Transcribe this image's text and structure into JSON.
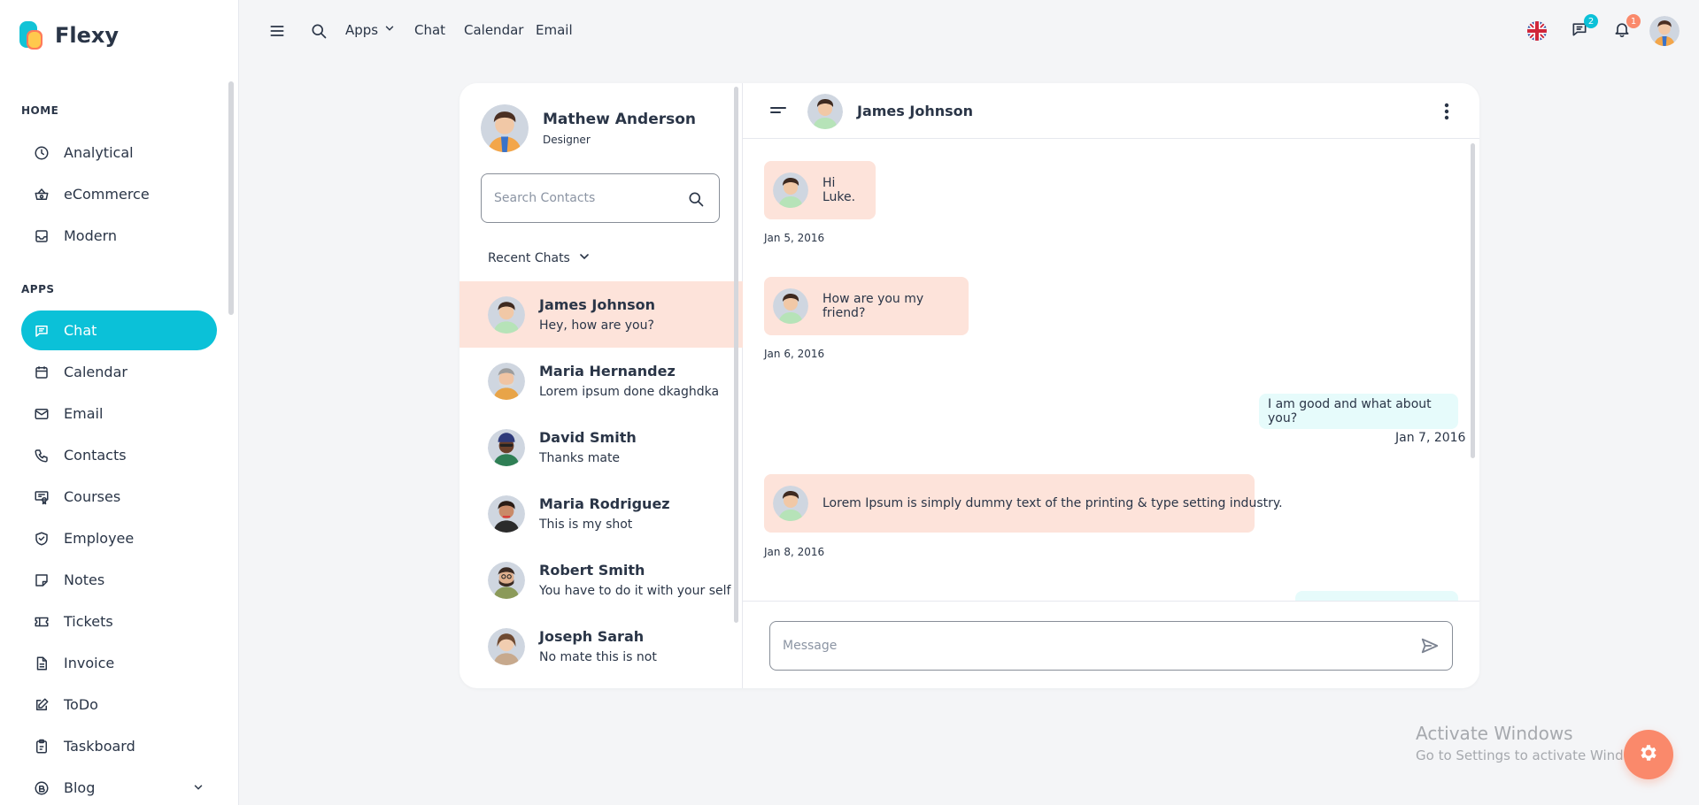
{
  "brand": {
    "name": "Flexy"
  },
  "sidebar": {
    "sections": [
      {
        "caption": "HOME",
        "items": [
          {
            "label": "Analytical",
            "icon": "clock-icon"
          },
          {
            "label": "eCommerce",
            "icon": "basket-icon"
          },
          {
            "label": "Modern",
            "icon": "inbox-icon"
          }
        ]
      },
      {
        "caption": "APPS",
        "items": [
          {
            "label": "Chat",
            "icon": "message-icon",
            "active": true
          },
          {
            "label": "Calendar",
            "icon": "calendar-icon"
          },
          {
            "label": "Email",
            "icon": "mail-icon"
          },
          {
            "label": "Contacts",
            "icon": "phone-icon"
          },
          {
            "label": "Courses",
            "icon": "certificate-icon"
          },
          {
            "label": "Employee",
            "icon": "shield-icon"
          },
          {
            "label": "Notes",
            "icon": "note-icon"
          },
          {
            "label": "Tickets",
            "icon": "ticket-icon"
          },
          {
            "label": "Invoice",
            "icon": "file-invoice-icon"
          },
          {
            "label": "ToDo",
            "icon": "edit-icon"
          },
          {
            "label": "Taskboard",
            "icon": "clipboard-icon"
          },
          {
            "label": "Blog",
            "icon": "blog-icon",
            "has_children": true
          }
        ]
      }
    ]
  },
  "topbar": {
    "links": [
      "Apps",
      "Chat",
      "Calendar",
      "Email"
    ],
    "messages_badge": "2",
    "notifications_badge": "1"
  },
  "profile": {
    "name": "Mathew Anderson",
    "role": "Designer"
  },
  "search": {
    "placeholder": "Search Contacts"
  },
  "recent_label": "Recent Chats",
  "contacts": [
    {
      "name": "James Johnson",
      "message": "Hey, how are you?",
      "selected": true
    },
    {
      "name": "Maria Hernandez",
      "message": "Lorem ipsum done dkaghdka"
    },
    {
      "name": "David Smith",
      "message": "Thanks mate"
    },
    {
      "name": "Maria Rodriguez",
      "message": "This is my shot"
    },
    {
      "name": "Robert Smith",
      "message": "You have to do it with your self"
    },
    {
      "name": "Joseph Sarah",
      "message": "No mate this is not"
    }
  ],
  "chat": {
    "partner": "James Johnson",
    "messages": [
      {
        "dir": "in",
        "text": "Hi Luke.",
        "date": "Jan 5, 2016"
      },
      {
        "dir": "in",
        "text": "How are you my friend?",
        "date": "Jan 6, 2016"
      },
      {
        "dir": "out",
        "text": "I am good and what about you?",
        "date": "Jan 7, 2016"
      },
      {
        "dir": "in",
        "text": "Lorem Ipsum is simply dummy text of the printing & type setting industry.",
        "date": "Jan 8, 2016"
      }
    ],
    "composer_placeholder": "Message"
  },
  "watermark": {
    "title": "Activate Windows",
    "subtitle": "Go to Settings to activate Windows."
  },
  "colors": {
    "accent": "#0bc1d8",
    "selected_bg": "#fde3da",
    "outgoing_bg": "#e6fbfb",
    "fab": "#fa896b"
  }
}
